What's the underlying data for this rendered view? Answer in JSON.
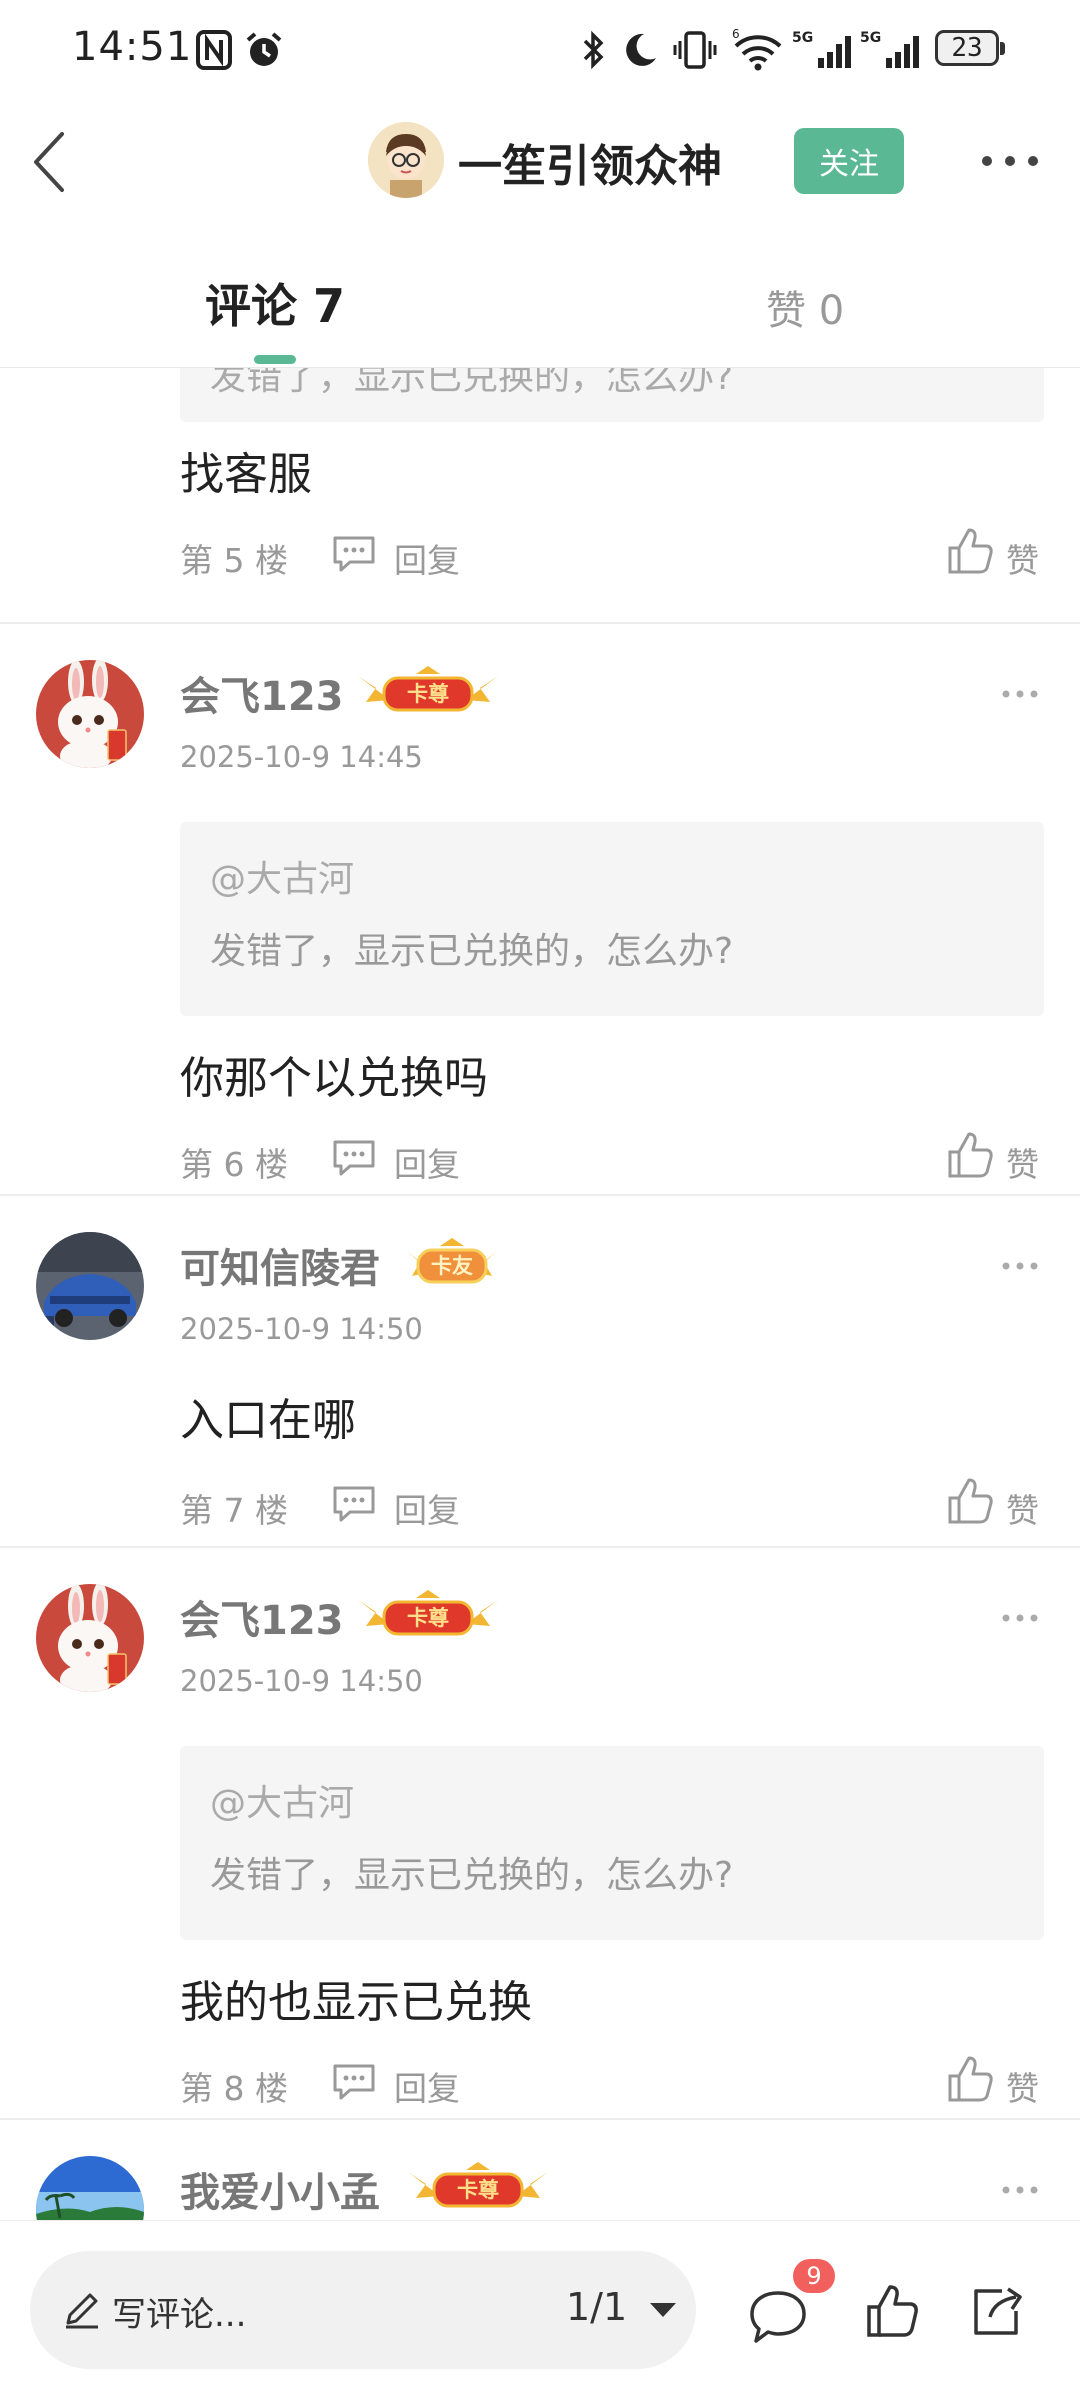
{
  "status_bar": {
    "time": "14:51",
    "battery": "23"
  },
  "header": {
    "author": "一笙引领众神",
    "follow_label": "关注"
  },
  "tabs": {
    "comments_label": "评论 7",
    "likes_label": "赞 0"
  },
  "partial_top": {
    "quote_text": "发错了，显示已兑换的，怎么办?",
    "text": "找客服",
    "floor": "第 5 楼",
    "reply_label": "回复",
    "like_label": "赞"
  },
  "comments": [
    {
      "user": "会飞123",
      "badge": "卡尊",
      "time": "2025-10-9 14:45",
      "quote_at": "@大古河",
      "quote_text": "发错了，显示已兑换的，怎么办?",
      "text": "你那个以兑换吗",
      "floor": "第 6 楼",
      "reply_label": "回复",
      "like_label": "赞"
    },
    {
      "user": "可知信陵君",
      "badge": "卡友",
      "time": "2025-10-9 14:50",
      "text": "入口在哪",
      "floor": "第 7 楼",
      "reply_label": "回复",
      "like_label": "赞"
    },
    {
      "user": "会飞123",
      "badge": "卡尊",
      "time": "2025-10-9 14:50",
      "quote_at": "@大古河",
      "quote_text": "发错了，显示已兑换的，怎么办?",
      "text": "我的也显示已兑换",
      "floor": "第 8 楼",
      "reply_label": "回复",
      "like_label": "赞"
    },
    {
      "user": "我爱小小孟",
      "badge": "卡尊"
    }
  ],
  "bottom_bar": {
    "compose_placeholder": "写评论...",
    "pager": "1/1",
    "comment_count": "9"
  },
  "colors": {
    "accent": "#5ab894",
    "badge_red": "#f1605c",
    "gold": "#f2b632"
  }
}
